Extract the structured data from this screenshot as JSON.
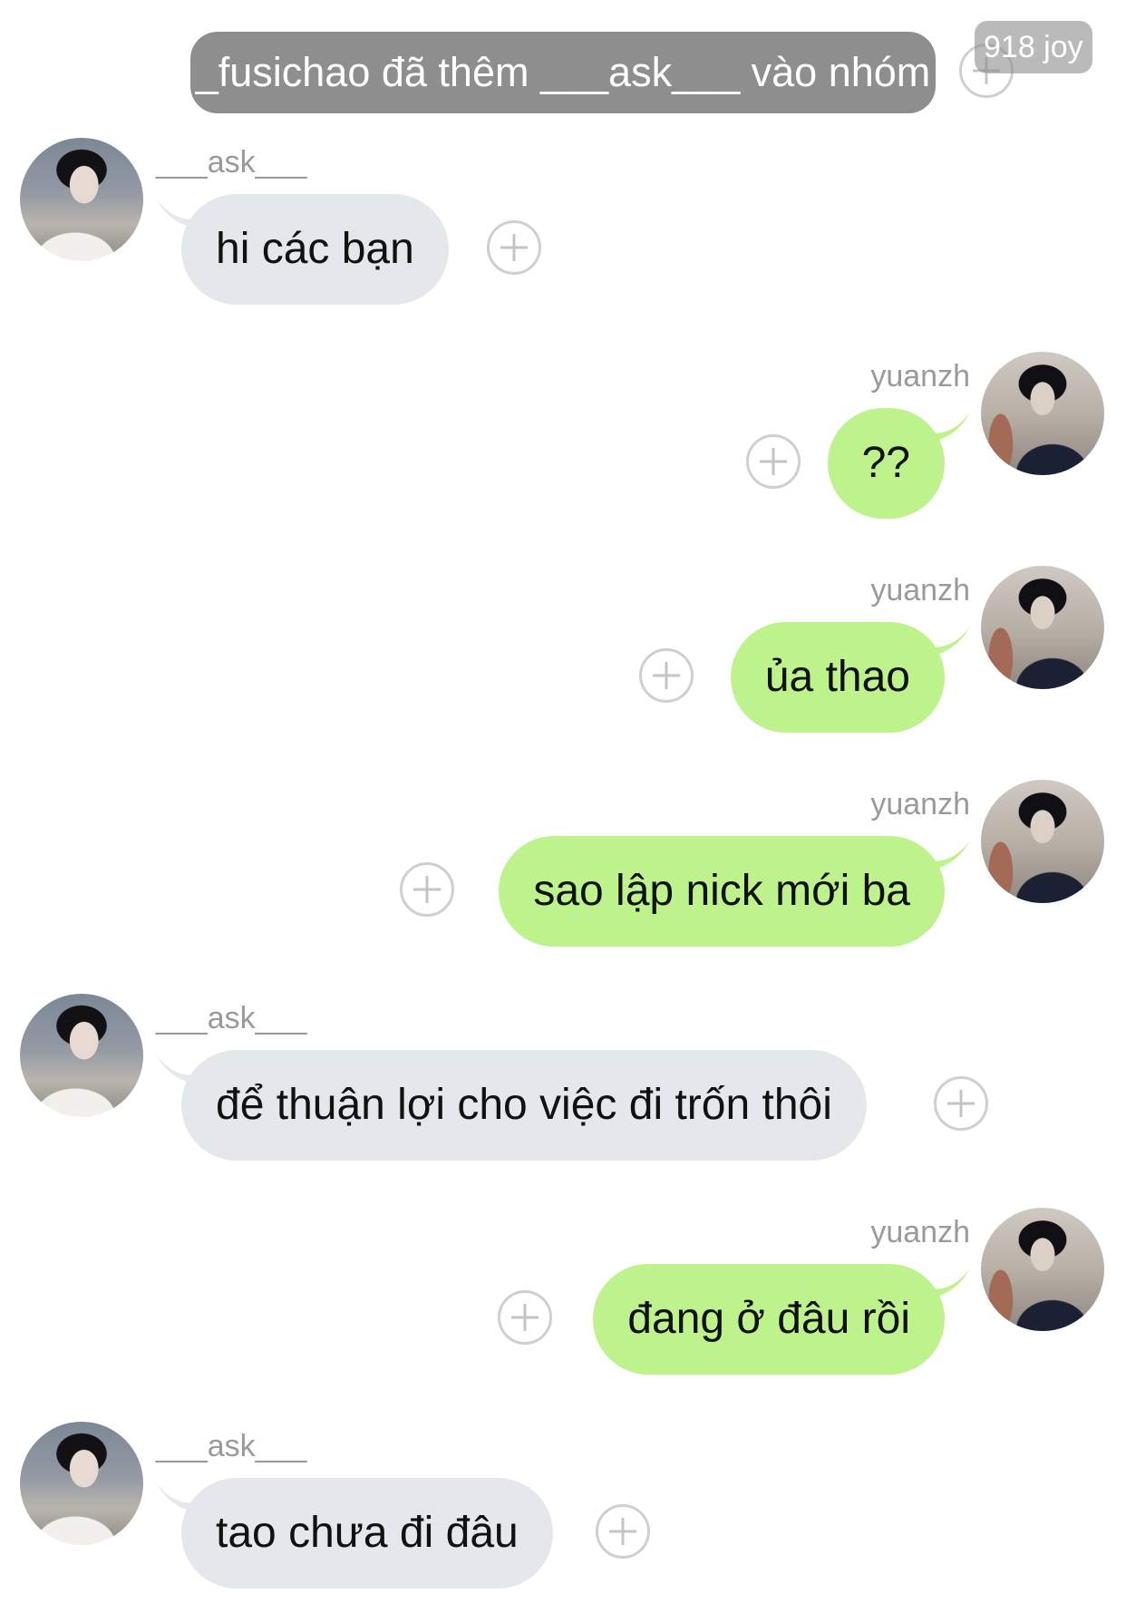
{
  "system": {
    "message": "_fusichao đã thêm ___ask___ vào nhóm",
    "watermark": "918 joy"
  },
  "messages": [
    {
      "side": "left",
      "sender": "___ask___",
      "text": "hi các bạn"
    },
    {
      "side": "right",
      "sender": "yuanzh",
      "text": "??"
    },
    {
      "side": "right",
      "sender": "yuanzh",
      "text": "ủa thao"
    },
    {
      "side": "right",
      "sender": "yuanzh",
      "text": "sao lập nick mới ba"
    },
    {
      "side": "left",
      "sender": "___ask___",
      "text": "để thuận lợi cho việc đi trốn thôi"
    },
    {
      "side": "right",
      "sender": "yuanzh",
      "text": "đang ở đâu rồi"
    },
    {
      "side": "left",
      "sender": "___ask___",
      "text": "tao chưa đi đâu"
    }
  ],
  "colors": {
    "incoming_bubble": "#e4e8ec",
    "outgoing_bubble": "#bdf28d",
    "system_pill": "#8e8e8e",
    "sender_name": "#9a9a9a"
  },
  "icons": {
    "add_reaction": "plus-circle-icon"
  }
}
